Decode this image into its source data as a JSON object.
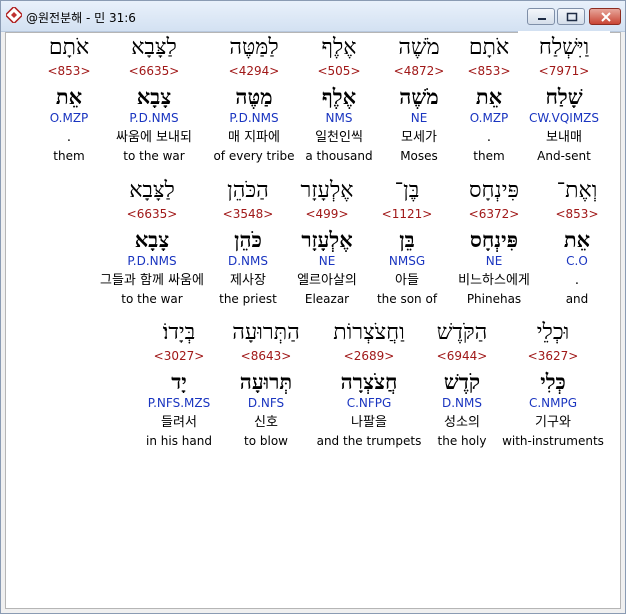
{
  "window": {
    "title": "@원전분해 - 민 31:6"
  },
  "colors": {
    "number": "#a01818",
    "morph": "#1a35c0",
    "text": "#000000"
  },
  "rows": [
    [
      {
        "heb": "וַיִּשְׁלַח",
        "num": "<7971>",
        "root": "שָׁלַח",
        "morph": "CW.VQIMZS",
        "kor": "보내매",
        "eng": "And-sent"
      },
      {
        "heb": "אֹתָם",
        "num": "<853>",
        "root": "אֵת",
        "morph": "O.MZP",
        "kor": ".",
        "eng": "them"
      },
      {
        "heb": "מֹשֶׁה",
        "num": "<4872>",
        "root": "מֹשֶׁה",
        "morph": "NE",
        "kor": "모세가",
        "eng": "Moses"
      },
      {
        "heb": "אֶלֶף",
        "num": "<505>",
        "root": "אֶלֶף",
        "morph": "NMS",
        "kor": "일천인씩",
        "eng": "a thousand"
      },
      {
        "heb": "לַמַּטֶּה",
        "num": "<4294>",
        "root": "מַטֶּה",
        "morph": "P.D.NMS",
        "kor": "매 지파에",
        "eng": "of every tribe"
      },
      {
        "heb": "לַצָּבָא",
        "num": "<6635>",
        "root": "צָבָא",
        "morph": "P.D.NMS",
        "kor": "싸움에 보내되",
        "eng": "to the war"
      },
      {
        "heb": "אֹתָם",
        "num": "<853>",
        "root": "אֵת",
        "morph": "O.MZP",
        "kor": ".",
        "eng": "them"
      }
    ],
    [
      {
        "heb": "וְאֶת־",
        "num": "<853>",
        "root": "אֵת",
        "morph": "C.O",
        "kor": ".",
        "eng": "and"
      },
      {
        "heb": "פִּינְחָס",
        "num": "<6372>",
        "root": "פִּינְחָס",
        "morph": "NE",
        "kor": "비느하스에게",
        "eng": "Phinehas"
      },
      {
        "heb": "בֶּן־",
        "num": "<1121>",
        "root": "בֵּן",
        "morph": "NMSG",
        "kor": "아들",
        "eng": "the son of"
      },
      {
        "heb": "אֶלְעָזָר",
        "num": "<499>",
        "root": "אֶלְעָזָר",
        "morph": "NE",
        "kor": "엘르아살의",
        "eng": "Eleazar"
      },
      {
        "heb": "הַכֹּהֵן",
        "num": "<3548>",
        "root": "כֹּהֵן",
        "morph": "D.NMS",
        "kor": "제사장",
        "eng": "the priest"
      },
      {
        "heb": "לַצָּבָא",
        "num": "<6635>",
        "root": "צָבָא",
        "morph": "P.D.NMS",
        "kor": "그들과 함께 싸움에",
        "eng": "to the war"
      }
    ],
    [
      {
        "heb": "וּכְלֵי",
        "num": "<3627>",
        "root": "כְּלִי",
        "morph": "C.NMPG",
        "kor": "기구와",
        "eng": "with-instruments"
      },
      {
        "heb": "הַקֹּדֶשׁ",
        "num": "<6944>",
        "root": "קֹדֶשׁ",
        "morph": "D.NMS",
        "kor": "성소의",
        "eng": "the holy"
      },
      {
        "heb": "וַחֲצֹצְרוֹת",
        "num": "<2689>",
        "root": "חֲצֹצְרָה",
        "morph": "C.NFPG",
        "kor": "나팔을",
        "eng": "and the trumpets"
      },
      {
        "heb": "הַתְּרוּעָה",
        "num": "<8643>",
        "root": "תְּרוּעָה",
        "morph": "D.NFS",
        "kor": "신호",
        "eng": "to blow"
      },
      {
        "heb": "בְּיָדוֹ׃",
        "num": "<3027>",
        "root": "יָד",
        "morph": "P.NFS.MZS",
        "kor": "들려서",
        "eng": "in his hand"
      }
    ]
  ]
}
